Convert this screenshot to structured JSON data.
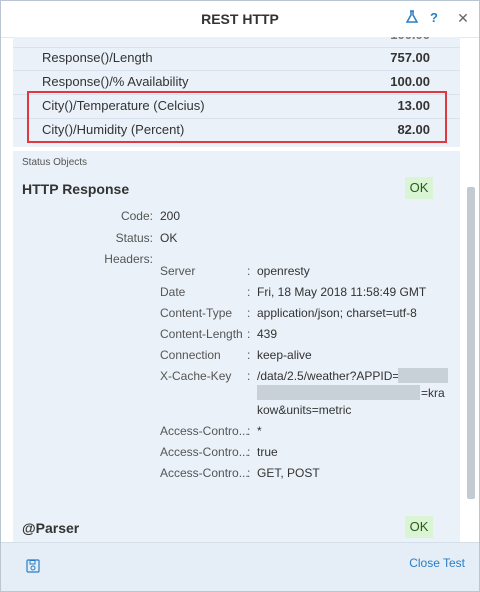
{
  "window": {
    "title": "REST HTTP"
  },
  "metrics": [
    {
      "name": "Response()/Length",
      "value": "757.00"
    },
    {
      "name": "Response()/% Availability",
      "value": "100.00"
    },
    {
      "name": "City()/Temperature (Celcius)",
      "value": "13.00"
    },
    {
      "name": "City()/Humidity (Percent)",
      "value": "82.00"
    }
  ],
  "status": {
    "section_label": "Status Objects",
    "http_response": {
      "title": "HTTP Response",
      "badge": "OK",
      "code_label": "Code:",
      "code_value": "200",
      "status_label": "Status:",
      "status_value": "OK",
      "headers_label": "Headers:",
      "headers": [
        {
          "name": "Server",
          "value": "openresty"
        },
        {
          "name": "Date",
          "value": "Fri, 18 May 2018 11:58:49 GMT"
        },
        {
          "name": "Content-Type",
          "value": "application/json; charset=utf-8"
        },
        {
          "name": "Content-Length",
          "value": "439"
        },
        {
          "name": "Connection",
          "value": "keep-alive"
        },
        {
          "name": "X-Cache-Key",
          "value": "/data/2.5/weather?APPID=",
          "value_2": "=kra",
          "value_3": "kow&units=metric"
        },
        {
          "name": "Access-Contro...",
          "value": "*"
        },
        {
          "name": "Access-Contro...",
          "value": "true"
        },
        {
          "name": "Access-Contro...",
          "value": "GET, POST"
        }
      ]
    },
    "parser": {
      "title": "@Parser",
      "badge": "OK"
    }
  },
  "footer": {
    "close_label": "Close Test"
  },
  "colors": {
    "accent": "#2a7dc4",
    "highlight": "#e0383e",
    "ok_bg": "#d9f5d3"
  }
}
